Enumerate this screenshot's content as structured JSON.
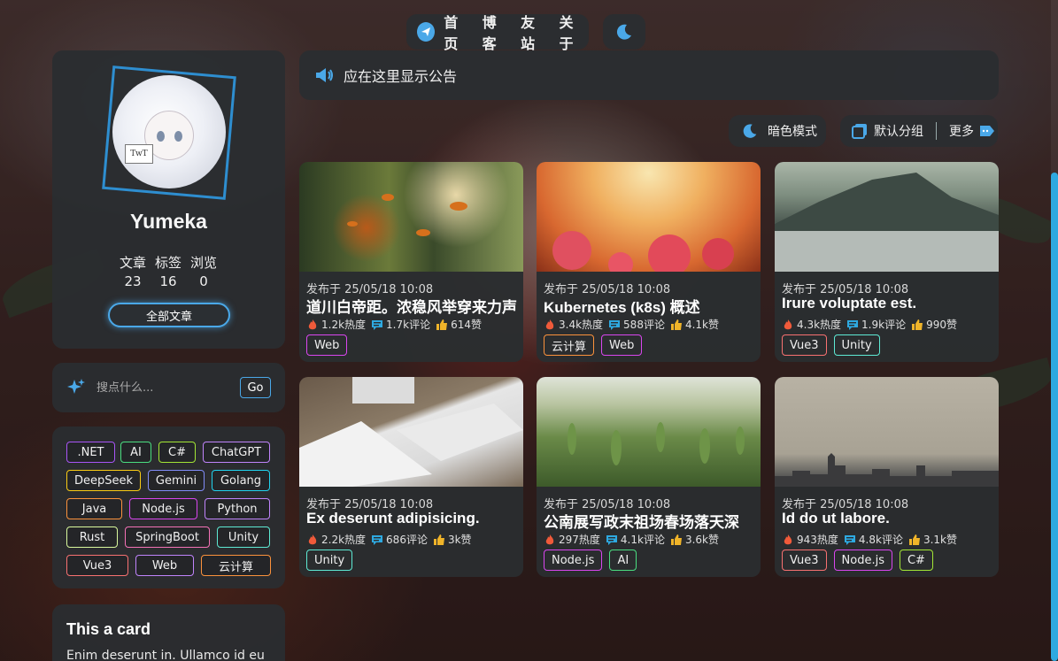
{
  "nav": {
    "links": [
      "首页",
      "博客",
      "友站",
      "关于"
    ]
  },
  "announcement": {
    "text": "应在这里显示公告"
  },
  "profile": {
    "name": "Yumeka",
    "avatar_sign": "TwT",
    "stats": [
      {
        "label": "文章",
        "value": "23"
      },
      {
        "label": "标签",
        "value": "16"
      },
      {
        "label": "浏览",
        "value": "0"
      }
    ],
    "all_posts_label": "全部文章"
  },
  "search": {
    "placeholder": "搜点什么...",
    "go_label": "Go"
  },
  "tag_cloud": [
    {
      "label": ".NET",
      "color": "#a855f7"
    },
    {
      "label": "AI",
      "color": "#4ade80"
    },
    {
      "label": "C#",
      "color": "#a3e635"
    },
    {
      "label": "ChatGPT",
      "color": "#c084fc"
    },
    {
      "label": "DeepSeek",
      "color": "#facc15"
    },
    {
      "label": "Gemini",
      "color": "#818cf8"
    },
    {
      "label": "Golang",
      "color": "#22d3ee"
    },
    {
      "label": "Java",
      "color": "#fb923c"
    },
    {
      "label": "Node.js",
      "color": "#d946ef"
    },
    {
      "label": "Python",
      "color": "#c084fc"
    },
    {
      "label": "Rust",
      "color": "#d9f99d"
    },
    {
      "label": "SpringBoot",
      "color": "#f472b6"
    },
    {
      "label": "Unity",
      "color": "#5eead4"
    },
    {
      "label": "Vue3",
      "color": "#f87171"
    },
    {
      "label": "Web",
      "color": "#c084fc"
    },
    {
      "label": "云计算",
      "color": "#fb923c"
    }
  ],
  "text_card": {
    "title": "This a card",
    "body": "Enim deserunt in. Ullamco id eu"
  },
  "toolbar": {
    "dark_mode": "暗色模式",
    "default_group": "默认分组",
    "more": "更多"
  },
  "posts": [
    {
      "date": "发布于 25/05/18 10:08",
      "title": "道川白帝距。浓稳风举穿来力声",
      "heat": "1.2k热度",
      "comments": "1.7k评论",
      "likes": "614赞",
      "image": "autumn-leaves",
      "tags": [
        {
          "label": "Web",
          "color": "#d946ef"
        }
      ]
    },
    {
      "date": "发布于 25/05/18 10:08",
      "title": "Kubernetes (k8s) 概述",
      "heat": "3.4k热度",
      "comments": "588评论",
      "likes": "4.1k赞",
      "image": "raspberries",
      "tags": [
        {
          "label": "云计算",
          "color": "#fb923c"
        },
        {
          "label": "Web",
          "color": "#d946ef"
        }
      ]
    },
    {
      "date": "发布于 25/05/18 10:08",
      "title": "Irure voluptate est.",
      "heat": "4.3k热度",
      "comments": "1.9k评论",
      "likes": "990赞",
      "image": "mountain-fog",
      "tags": [
        {
          "label": "Vue3",
          "color": "#f87171"
        },
        {
          "label": "Unity",
          "color": "#5eead4"
        }
      ]
    },
    {
      "date": "发布于 25/05/18 10:08",
      "title": "Ex deserunt adipisicing.",
      "heat": "2.2k热度",
      "comments": "686评论",
      "likes": "3k赞",
      "image": "keyboard-tablet",
      "tags": [
        {
          "label": "Unity",
          "color": "#5eead4"
        }
      ]
    },
    {
      "date": "发布于 25/05/18 10:08",
      "title": "公南展写政末祖场春场落天深",
      "heat": "297热度",
      "comments": "4.1k评论",
      "likes": "3.6k赞",
      "image": "wheat-field",
      "tags": [
        {
          "label": "Node.js",
          "color": "#d946ef"
        },
        {
          "label": "AI",
          "color": "#4ade80"
        }
      ]
    },
    {
      "date": "发布于 25/05/18 10:08",
      "title": "Id do ut labore.",
      "heat": "943热度",
      "comments": "4.8k评论",
      "likes": "3.1k赞",
      "image": "city-skyline",
      "tags": [
        {
          "label": "Vue3",
          "color": "#f87171"
        },
        {
          "label": "Node.js",
          "color": "#d946ef"
        },
        {
          "label": "C#",
          "color": "#a3e635"
        }
      ]
    }
  ],
  "colors": {
    "accent": "#4aa8e8",
    "panel": "#2a2d30",
    "heat_icon": "#f05a3a",
    "comment_icon": "#2ea9e0",
    "like_icon": "#f0b429"
  }
}
